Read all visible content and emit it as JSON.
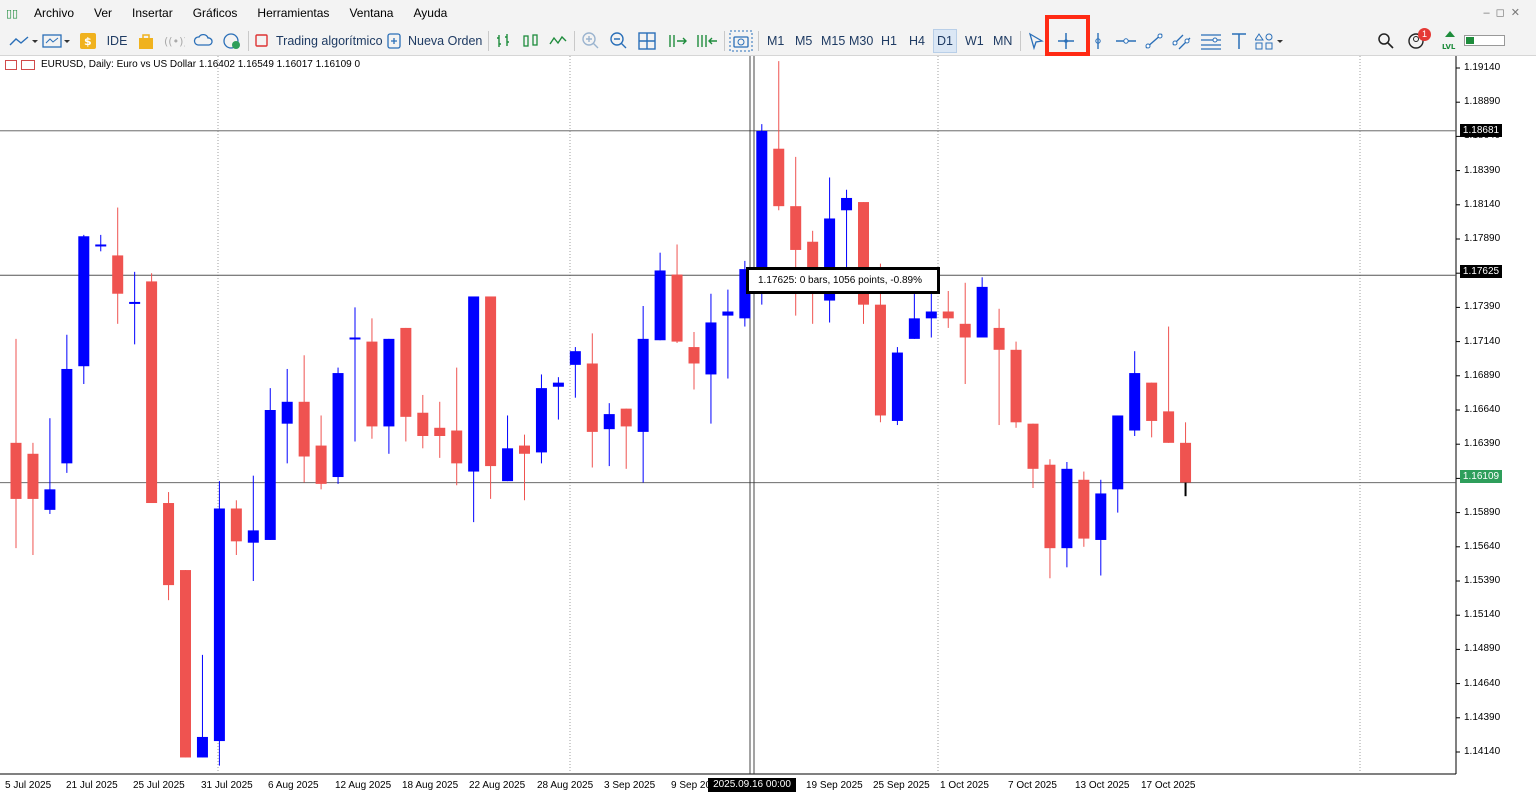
{
  "menu": [
    "Archivo",
    "Ver",
    "Insertar",
    "Gráficos",
    "Herramientas",
    "Ventana",
    "Ayuda"
  ],
  "toolbar": {
    "ide_label": "IDE",
    "algo_trading_label": "Trading algorítmico",
    "new_order_label": "Nueva Orden",
    "timeframes": [
      "M1",
      "M5",
      "M15",
      "M30",
      "H1",
      "H4",
      "D1",
      "W1",
      "MN"
    ],
    "active_timeframe": "D1",
    "notifications_count": "1",
    "highlight_color": "#ff2a14"
  },
  "chart": {
    "header": "EURUSD, Daily:  Euro vs US Dollar  1.16402 1.16549 1.16017 1.16109  0",
    "price_axis": [
      "1.19140",
      "1.18890",
      "1.18640",
      "1.18390",
      "1.18140",
      "1.17890",
      "1.17640",
      "1.17390",
      "1.17140",
      "1.16890",
      "1.16640",
      "1.16390",
      "1.16140",
      "1.15890",
      "1.15640",
      "1.15390",
      "1.15140",
      "1.14890",
      "1.14640",
      "1.14390",
      "1.14140"
    ],
    "price_tags": {
      "high_line": "1.18681",
      "crosshair": "1.17625",
      "current": "1.16109"
    },
    "date_axis": [
      "5 Jul 2025",
      "21 Jul 2025",
      "25 Jul 2025",
      "31 Jul 2025",
      "6 Aug 2025",
      "12 Aug 2025",
      "18 Aug 2025",
      "22 Aug 2025",
      "28 Aug 2025",
      "3 Sep 2025",
      "9 Sep 20",
      "19 Sep 2025",
      "25 Sep 2025",
      "1 Oct 2025",
      "7 Oct 2025",
      "13 Oct 2025",
      "17 Oct 2025"
    ],
    "date_tag": "2025.09.16 00:00",
    "tooltip": "1.17625: 0 bars, 1056 points, -0.89%",
    "colors": {
      "bull": "#0000ff",
      "bear": "#ef5350"
    }
  },
  "chart_data": {
    "type": "candlestick",
    "symbol": "EURUSD",
    "timeframe": "Daily",
    "ylim": [
      1.1389,
      1.1935
    ],
    "candles": [
      {
        "o": 1.164,
        "h": 1.1716,
        "l": 1.1563,
        "c": 1.1599
      },
      {
        "o": 1.1632,
        "h": 1.164,
        "l": 1.1558,
        "c": 1.1599
      },
      {
        "o": 1.1591,
        "h": 1.1658,
        "l": 1.1588,
        "c": 1.1606
      },
      {
        "o": 1.1625,
        "h": 1.1719,
        "l": 1.1618,
        "c": 1.1694
      },
      {
        "o": 1.1696,
        "h": 1.1792,
        "l": 1.1683,
        "c": 1.1791
      },
      {
        "o": 1.1784,
        "h": 1.1792,
        "l": 1.178,
        "c": 1.1785
      },
      {
        "o": 1.1777,
        "h": 1.1812,
        "l": 1.1727,
        "c": 1.1749
      },
      {
        "o": 1.1743,
        "h": 1.1765,
        "l": 1.1712,
        "c": 1.1743
      },
      {
        "o": 1.1758,
        "h": 1.1764,
        "l": 1.1596,
        "c": 1.1596
      },
      {
        "o": 1.1596,
        "h": 1.1604,
        "l": 1.1525,
        "c": 1.1536
      },
      {
        "o": 1.1547,
        "h": 1.1547,
        "l": 1.141,
        "c": 1.141
      },
      {
        "o": 1.141,
        "h": 1.1485,
        "l": 1.141,
        "c": 1.1425
      },
      {
        "o": 1.1422,
        "h": 1.1612,
        "l": 1.1404,
        "c": 1.1592
      },
      {
        "o": 1.1592,
        "h": 1.1598,
        "l": 1.1558,
        "c": 1.1568
      },
      {
        "o": 1.1567,
        "h": 1.1616,
        "l": 1.1539,
        "c": 1.1576
      },
      {
        "o": 1.1569,
        "h": 1.168,
        "l": 1.157,
        "c": 1.1664
      },
      {
        "o": 1.1654,
        "h": 1.1694,
        "l": 1.1625,
        "c": 1.167
      },
      {
        "o": 1.167,
        "h": 1.1704,
        "l": 1.1611,
        "c": 1.163
      },
      {
        "o": 1.1638,
        "h": 1.166,
        "l": 1.1606,
        "c": 1.161
      },
      {
        "o": 1.1615,
        "h": 1.1695,
        "l": 1.161,
        "c": 1.1691
      },
      {
        "o": 1.1717,
        "h": 1.1739,
        "l": 1.1641,
        "c": 1.1717
      },
      {
        "o": 1.1714,
        "h": 1.1731,
        "l": 1.1643,
        "c": 1.1652
      },
      {
        "o": 1.1652,
        "h": 1.1702,
        "l": 1.1632,
        "c": 1.1716
      },
      {
        "o": 1.1724,
        "h": 1.1724,
        "l": 1.1641,
        "c": 1.1659
      },
      {
        "o": 1.1662,
        "h": 1.1675,
        "l": 1.1636,
        "c": 1.1645
      },
      {
        "o": 1.1651,
        "h": 1.167,
        "l": 1.1629,
        "c": 1.1645
      },
      {
        "o": 1.1649,
        "h": 1.1695,
        "l": 1.1609,
        "c": 1.1625
      },
      {
        "o": 1.1619,
        "h": 1.1745,
        "l": 1.1582,
        "c": 1.1747
      },
      {
        "o": 1.1747,
        "h": 1.1744,
        "l": 1.1599,
        "c": 1.1623
      },
      {
        "o": 1.1612,
        "h": 1.166,
        "l": 1.1612,
        "c": 1.1636
      },
      {
        "o": 1.1638,
        "h": 1.1646,
        "l": 1.1598,
        "c": 1.1632
      },
      {
        "o": 1.1633,
        "h": 1.169,
        "l": 1.1625,
        "c": 1.168
      },
      {
        "o": 1.1681,
        "h": 1.1688,
        "l": 1.1657,
        "c": 1.1684
      },
      {
        "o": 1.1697,
        "h": 1.171,
        "l": 1.1673,
        "c": 1.1707
      },
      {
        "o": 1.1698,
        "h": 1.172,
        "l": 1.1622,
        "c": 1.1648
      },
      {
        "o": 1.165,
        "h": 1.1669,
        "l": 1.1623,
        "c": 1.1661
      },
      {
        "o": 1.1665,
        "h": 1.1657,
        "l": 1.1621,
        "c": 1.1652
      },
      {
        "o": 1.1648,
        "h": 1.174,
        "l": 1.1611,
        "c": 1.1716
      },
      {
        "o": 1.1715,
        "h": 1.1779,
        "l": 1.1715,
        "c": 1.1766
      },
      {
        "o": 1.1763,
        "h": 1.1785,
        "l": 1.1713,
        "c": 1.1714
      },
      {
        "o": 1.171,
        "h": 1.1721,
        "l": 1.1679,
        "c": 1.1698
      },
      {
        "o": 1.169,
        "h": 1.1749,
        "l": 1.1654,
        "c": 1.1728
      },
      {
        "o": 1.1733,
        "h": 1.1752,
        "l": 1.1687,
        "c": 1.1736
      },
      {
        "o": 1.1731,
        "h": 1.1773,
        "l": 1.1725,
        "c": 1.1767
      },
      {
        "o": 1.176,
        "h": 1.1873,
        "l": 1.1741,
        "c": 1.1868
      },
      {
        "o": 1.1855,
        "h": 1.1919,
        "l": 1.181,
        "c": 1.1813
      },
      {
        "o": 1.1813,
        "h": 1.1849,
        "l": 1.1733,
        "c": 1.1781
      },
      {
        "o": 1.1787,
        "h": 1.1795,
        "l": 1.1727,
        "c": 1.175
      },
      {
        "o": 1.1744,
        "h": 1.1834,
        "l": 1.1728,
        "c": 1.1804
      },
      {
        "o": 1.181,
        "h": 1.1825,
        "l": 1.1764,
        "c": 1.1819
      },
      {
        "o": 1.1816,
        "h": 1.181,
        "l": 1.1727,
        "c": 1.1741
      },
      {
        "o": 1.1741,
        "h": 1.1771,
        "l": 1.1655,
        "c": 1.166
      },
      {
        "o": 1.1656,
        "h": 1.171,
        "l": 1.1653,
        "c": 1.1706
      },
      {
        "o": 1.1716,
        "h": 1.1751,
        "l": 1.1717,
        "c": 1.1731
      },
      {
        "o": 1.1731,
        "h": 1.1756,
        "l": 1.1717,
        "c": 1.1736
      },
      {
        "o": 1.1736,
        "h": 1.1751,
        "l": 1.1724,
        "c": 1.1731
      },
      {
        "o": 1.1727,
        "h": 1.1757,
        "l": 1.1683,
        "c": 1.1717
      },
      {
        "o": 1.1717,
        "h": 1.1761,
        "l": 1.1717,
        "c": 1.1754
      },
      {
        "o": 1.1724,
        "h": 1.1738,
        "l": 1.1653,
        "c": 1.1708
      },
      {
        "o": 1.1708,
        "h": 1.1714,
        "l": 1.1651,
        "c": 1.1655
      },
      {
        "o": 1.1654,
        "h": 1.1652,
        "l": 1.1607,
        "c": 1.1621
      },
      {
        "o": 1.1624,
        "h": 1.1628,
        "l": 1.1541,
        "c": 1.1563
      },
      {
        "o": 1.1563,
        "h": 1.1626,
        "l": 1.1549,
        "c": 1.1621
      },
      {
        "o": 1.1613,
        "h": 1.1619,
        "l": 1.1564,
        "c": 1.157
      },
      {
        "o": 1.1569,
        "h": 1.1613,
        "l": 1.1543,
        "c": 1.1603
      },
      {
        "o": 1.1606,
        "h": 1.1649,
        "l": 1.1589,
        "c": 1.166
      },
      {
        "o": 1.1649,
        "h": 1.1707,
        "l": 1.1645,
        "c": 1.1691
      },
      {
        "o": 1.1684,
        "h": 1.1683,
        "l": 1.1644,
        "c": 1.1656
      },
      {
        "o": 1.1663,
        "h": 1.1725,
        "l": 1.164,
        "c": 1.164
      },
      {
        "o": 1.164,
        "h": 1.1655,
        "l": 1.1602,
        "c": 1.1611
      }
    ],
    "horizontal_lines": [
      1.18681,
      1.17625,
      1.16109
    ]
  }
}
